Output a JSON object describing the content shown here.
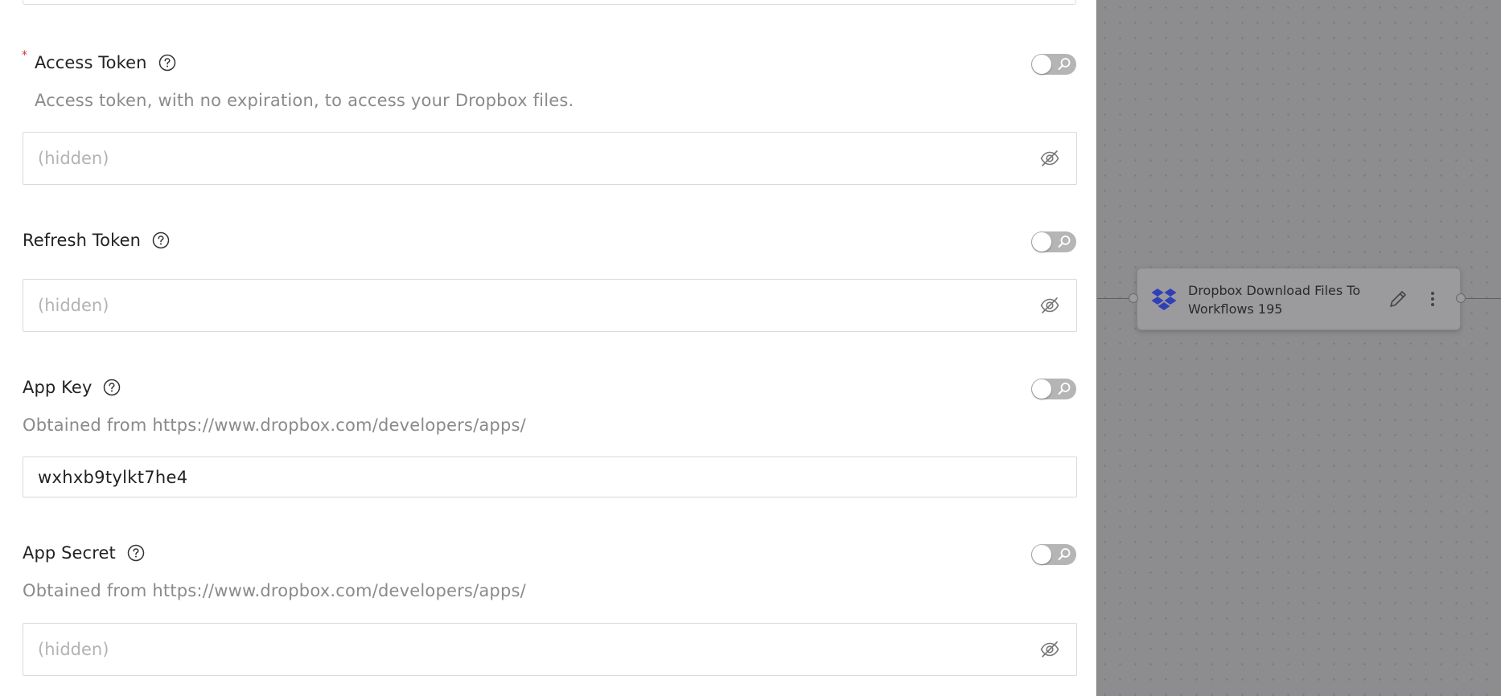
{
  "form": {
    "fields": [
      {
        "key": "access_token",
        "label": "Access Token",
        "required_mark": "*",
        "description": "Access token, with no expiration, to access your Dropbox files.",
        "placeholder": "(hidden)",
        "value": ""
      },
      {
        "key": "refresh_token",
        "label": "Refresh Token",
        "description": "",
        "placeholder": "(hidden)",
        "value": ""
      },
      {
        "key": "app_key",
        "label": "App Key",
        "description": "Obtained from https://www.dropbox.com/developers/apps/",
        "placeholder": "",
        "value": "wxhxb9tylkt7he4"
      },
      {
        "key": "app_secret",
        "label": "App Secret",
        "description": "Obtained from https://www.dropbox.com/developers/apps/",
        "placeholder": "(hidden)",
        "value": ""
      }
    ],
    "icons": {
      "help": "question-circle-icon",
      "toggle": "search-toggle",
      "reveal": "eye-off-icon"
    }
  },
  "canvas": {
    "node": {
      "title": "Dropbox Download Files To Workflows 195",
      "logo_color": "#2f3fb6",
      "icons": [
        "dropbox-icon",
        "pencil-icon",
        "more-vertical-icon"
      ]
    }
  },
  "colors": {
    "required": "#d93025",
    "toggle_off": "#b5b5b5",
    "canvas_bg": "#8d8d90"
  }
}
